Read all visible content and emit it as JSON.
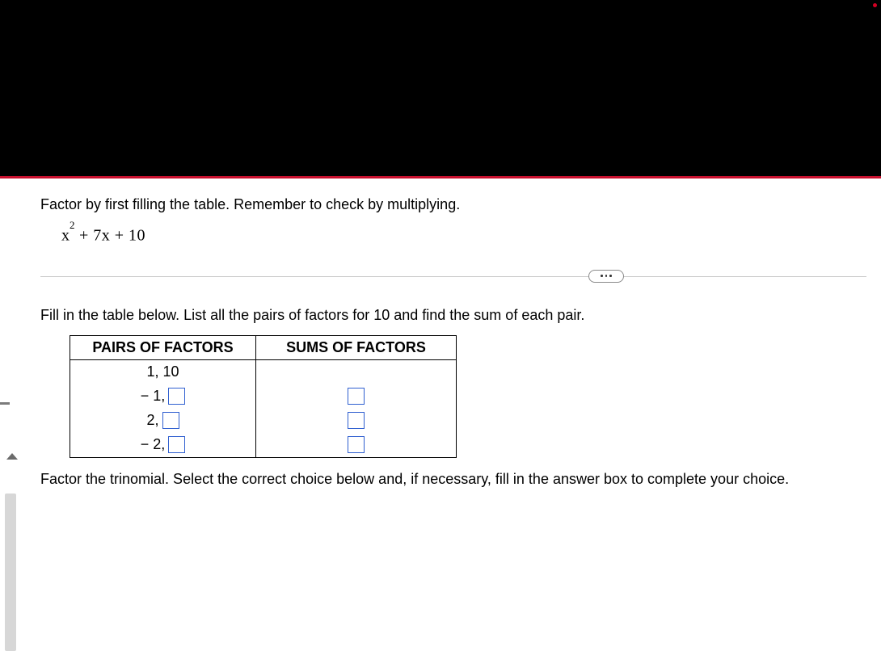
{
  "problem": {
    "instruction": "Factor by first filling the table. Remember to check by multiplying.",
    "expression_base": "x",
    "expression_exp": "2",
    "expression_mid": " + 7x + 10"
  },
  "table": {
    "lead": "Fill in the table below. List all the pairs of factors for 10 and find the sum of each pair.",
    "header_pairs": "PAIRS OF FACTORS",
    "header_sums": "SUMS OF FACTORS",
    "rows": [
      {
        "pair_prefix": "1, 10",
        "has_fill_pair": false,
        "has_fill_sum": false
      },
      {
        "pair_prefix": "− 1,",
        "has_fill_pair": true,
        "has_fill_sum": true
      },
      {
        "pair_prefix": "2,",
        "has_fill_pair": true,
        "has_fill_sum": true
      },
      {
        "pair_prefix": "− 2,",
        "has_fill_pair": true,
        "has_fill_sum": true
      }
    ]
  },
  "final": "Factor the trinomial. Select the correct choice below and, if necessary, fill in the answer box to complete your choice."
}
